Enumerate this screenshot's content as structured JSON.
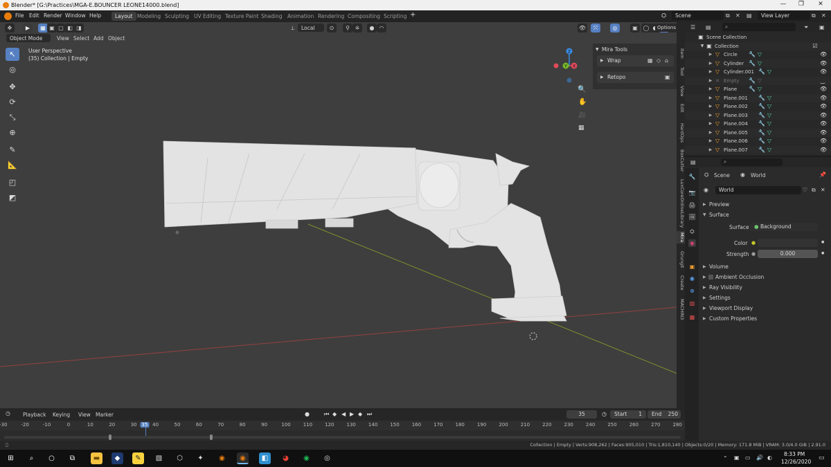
{
  "window": {
    "title": "Blender* [G:\\Practices\\MGA-E.BOUNCER LEONE14000.blend]",
    "controls": [
      "—",
      "❐",
      "✕"
    ]
  },
  "menu": [
    "File",
    "Edit",
    "Render",
    "Window",
    "Help"
  ],
  "workspace_tabs": [
    {
      "label": "Layout",
      "active": true
    },
    {
      "label": "Modeling",
      "active": false
    },
    {
      "label": "Sculpting",
      "active": false
    },
    {
      "label": "UV Editing",
      "active": false
    },
    {
      "label": "Texture Paint",
      "active": false
    },
    {
      "label": "Shading",
      "active": false
    },
    {
      "label": "Animation",
      "active": false
    },
    {
      "label": "Rendering",
      "active": false
    },
    {
      "label": "Compositing",
      "active": false
    },
    {
      "label": "Scripting",
      "active": false
    }
  ],
  "add_workspace": "+",
  "scene": {
    "name": "Scene"
  },
  "view_layer": {
    "name": "View Layer"
  },
  "viewport": {
    "mode": "Object Mode",
    "menus": [
      "View",
      "Select",
      "Add",
      "Object"
    ],
    "orientation": "Local",
    "options_label": "Options",
    "perspective_label": "User Perspective",
    "collection_info": "(35) Collection | Empty"
  },
  "gizmo": {
    "axes": [
      "Z",
      "Y",
      "X"
    ],
    "colors": {
      "x": "#e04a5a",
      "y": "#76b82a",
      "z": "#3a8ee6"
    }
  },
  "mira_tools": {
    "title": "Mira Tools",
    "items": [
      {
        "label": "Wrap"
      },
      {
        "label": "Retopo"
      }
    ]
  },
  "side_tabs": [
    "Item",
    "Tool",
    "View",
    "Edit",
    "HardOps",
    "BoxCutter",
    "LuxCoreOnlineLibrary",
    "Mira",
    "Grungit",
    "Create",
    "MACHIN3"
  ],
  "side_tab_active": "Mira",
  "outliner": {
    "root": "Scene Collection",
    "collection": "Collection",
    "objects": [
      {
        "name": "Circle",
        "disabled": false
      },
      {
        "name": "Cylinder",
        "disabled": false
      },
      {
        "name": "Cylinder.001",
        "disabled": false
      },
      {
        "name": "Empty",
        "disabled": true
      },
      {
        "name": "Plane",
        "disabled": false
      },
      {
        "name": "Plane.001",
        "disabled": false
      },
      {
        "name": "Plane.002",
        "disabled": false
      },
      {
        "name": "Plane.003",
        "disabled": false
      },
      {
        "name": "Plane.004",
        "disabled": false
      },
      {
        "name": "Plane.005",
        "disabled": false
      },
      {
        "name": "Plane.006",
        "disabled": false
      },
      {
        "name": "Plane.007",
        "disabled": false
      }
    ]
  },
  "properties": {
    "breadcrumb": [
      "Scene",
      "World"
    ],
    "world_name": "World",
    "panels": {
      "preview": "Preview",
      "surface": "Surface",
      "surface_label": "Surface",
      "surface_value": "Background",
      "color_label": "Color",
      "strength_label": "Strength",
      "strength_value": "0.000",
      "collapsed": [
        "Volume",
        "Ambient Occlusion",
        "Ray Visibility",
        "Settings",
        "Viewport Display",
        "Custom Properties"
      ]
    }
  },
  "timeline": {
    "menus": [
      "Playback",
      "Keying",
      "View",
      "Marker"
    ],
    "current_frame": "35",
    "start_label": "Start",
    "start_value": "1",
    "end_label": "End",
    "end_value": "250",
    "ticks": [
      "-30",
      "-20",
      "-10",
      "0",
      "10",
      "20",
      "30",
      "35",
      "40",
      "50",
      "60",
      "70",
      "80",
      "90",
      "100",
      "110",
      "120",
      "130",
      "140",
      "150",
      "160",
      "170",
      "180",
      "190",
      "200",
      "210",
      "220",
      "230",
      "240",
      "250",
      "260",
      "270",
      "280"
    ]
  },
  "status": "Collection | Empty | Verts:908,262 | Faces:905,010 | Tris:1,810,140 | Objects:0/20 | Memory: 171.8 MiB | VRAM: 3.0/4.0 GiB | 2.91.0",
  "taskbar": {
    "time": "8:33 PM",
    "date": "12/26/2020"
  },
  "colors": {
    "accent": "#5680c2",
    "viewport_bg": "#3e3e3e",
    "x_axis": "#b8443f",
    "y_axis": "#8fa229"
  }
}
